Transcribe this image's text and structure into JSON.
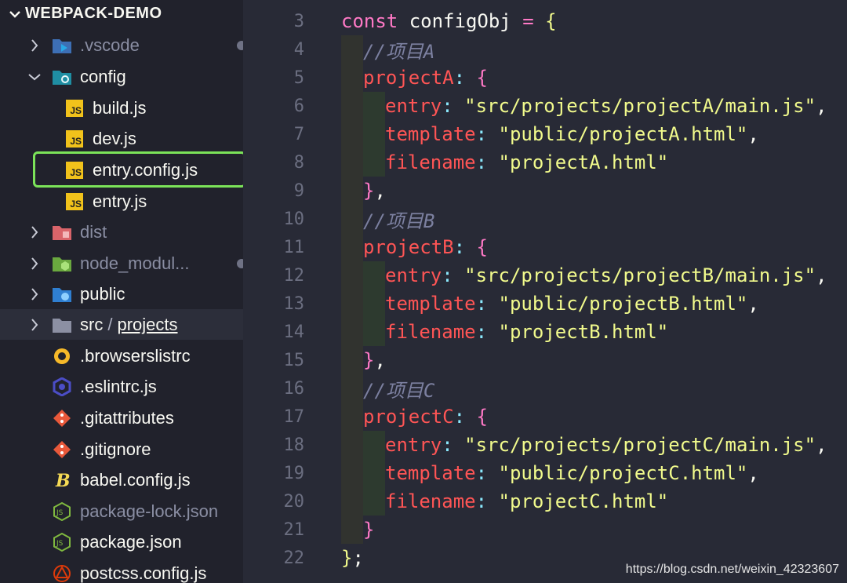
{
  "explorer": {
    "title": "WEBPACK-DEMO",
    "items": [
      {
        "label": ".vscode",
        "icon": "vscode-folder-icon"
      },
      {
        "label": "config",
        "icon": "config-folder-icon"
      },
      {
        "label": "build.js",
        "icon": "js-file-icon"
      },
      {
        "label": "dev.js",
        "icon": "js-file-icon"
      },
      {
        "label": "entry.config.js",
        "icon": "js-file-icon"
      },
      {
        "label": "entry.js",
        "icon": "js-file-icon"
      },
      {
        "label": "dist",
        "icon": "dist-folder-icon"
      },
      {
        "label": "node_modul...",
        "icon": "node-modules-folder-icon"
      },
      {
        "label": "public",
        "icon": "public-folder-icon"
      },
      {
        "label": "src",
        "label2": "projects",
        "separator": "/",
        "icon": "folder-icon"
      },
      {
        "label": ".browserslistrc",
        "icon": "browserslist-icon"
      },
      {
        "label": ".eslintrc.js",
        "icon": "eslint-icon"
      },
      {
        "label": ".gitattributes",
        "icon": "git-icon"
      },
      {
        "label": ".gitignore",
        "icon": "git-icon"
      },
      {
        "label": "babel.config.js",
        "icon": "babel-icon"
      },
      {
        "label": "package-lock.json",
        "icon": "json-icon"
      },
      {
        "label": "package.json",
        "icon": "json-icon"
      },
      {
        "label": "postcss.config.js",
        "icon": "postcss-icon"
      }
    ],
    "js_badge": "JS"
  },
  "editor": {
    "line_numbers": [
      "3",
      "4",
      "5",
      "6",
      "7",
      "8",
      "9",
      "10",
      "11",
      "12",
      "13",
      "14",
      "15",
      "16",
      "17",
      "18",
      "19",
      "20",
      "21",
      "22"
    ],
    "code": {
      "kw_const": "const",
      "var_name": "configObj",
      "eq": "=",
      "open_brace": "{",
      "close_brace": "}",
      "semicolon": ";",
      "comment_a": "//项目A",
      "comment_b": "//项目B",
      "comment_c": "//项目C",
      "projectA": "projectA",
      "projectB": "projectB",
      "projectC": "projectC",
      "colon": ":",
      "comma": ",",
      "entry": "entry",
      "template": "template",
      "filename": "filename",
      "a_entry": "\"src/projects/projectA/main.js\"",
      "a_template": "\"public/projectA.html\"",
      "a_filename": "\"projectA.html\"",
      "b_entry": "\"src/projects/projectB/main.js\"",
      "b_template": "\"public/projectB.html\"",
      "b_filename": "\"projectB.html\"",
      "c_entry": "\"src/projects/projectC/main.js\"",
      "c_template": "\"public/projectC.html\"",
      "c_filename": "\"projectC.html\""
    }
  },
  "watermark": "https://blog.csdn.net/weixin_42323607",
  "colors": {
    "highlight": "#7be359",
    "editor_bg": "#282a36",
    "sidebar_bg": "#21222c"
  }
}
